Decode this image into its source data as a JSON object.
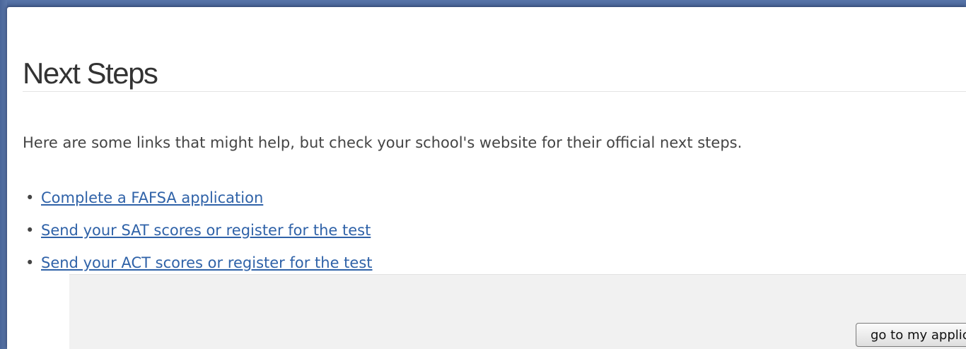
{
  "page": {
    "title": "Next Steps",
    "intro": "Here are some links that might help, but check your school's website for their official next steps."
  },
  "links": [
    {
      "bullet": "•",
      "label": "Complete a FAFSA application"
    },
    {
      "bullet": "•",
      "label": "Send your SAT scores or register for the test"
    },
    {
      "bullet": "•",
      "label": "Send your ACT scores or register for the test"
    }
  ],
  "footer": {
    "button_label": "go to my applications"
  },
  "colors": {
    "background": "#3f5b8f",
    "link": "#2f62a8",
    "heading": "#333333"
  }
}
